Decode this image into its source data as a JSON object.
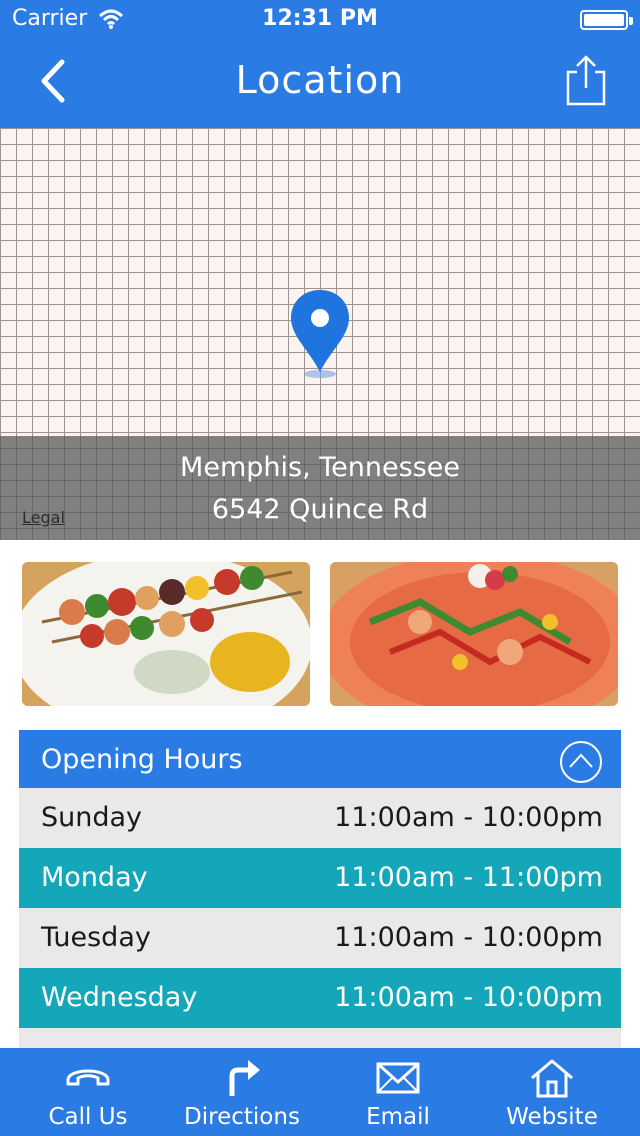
{
  "status_bar": {
    "carrier": "Carrier",
    "time": "12:31 PM"
  },
  "nav": {
    "title": "Location"
  },
  "map": {
    "city": "Memphis, Tennessee",
    "street": "6542 Quince Rd",
    "legal": "Legal"
  },
  "hours": {
    "title": "Opening Hours",
    "rows": [
      {
        "day": "Sunday",
        "time": "11:00am - 10:00pm"
      },
      {
        "day": "Monday",
        "time": "11:00am - 11:00pm"
      },
      {
        "day": "Tuesday",
        "time": "11:00am - 10:00pm"
      },
      {
        "day": "Wednesday",
        "time": "11:00am - 10:00pm"
      }
    ]
  },
  "tabbar": {
    "items": [
      {
        "label": "Call Us",
        "icon": "phone-icon"
      },
      {
        "label": "Directions",
        "icon": "turn-right-arrow-icon"
      },
      {
        "label": "Email",
        "icon": "envelope-icon"
      },
      {
        "label": "Website",
        "icon": "home-icon"
      }
    ]
  },
  "colors": {
    "primary_blue": "#2a7be4",
    "teal_row": "#13a7b9",
    "grey_row": "#ebe8e9",
    "map_background": "#fcf3ee"
  }
}
